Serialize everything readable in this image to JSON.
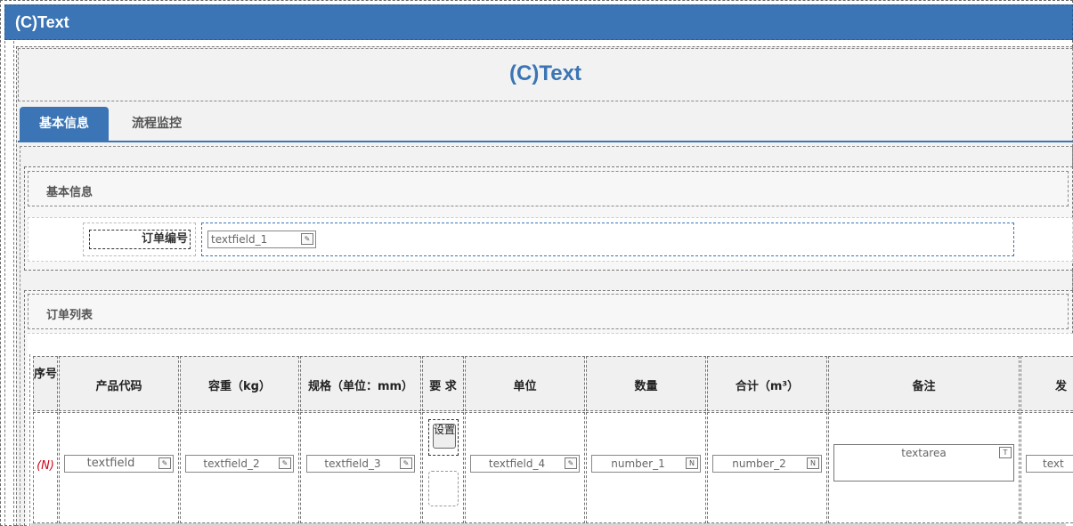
{
  "app": {
    "header_title": "(C)Text",
    "page_title": "(C)Text"
  },
  "tabs": [
    {
      "label": "基本信息",
      "active": true
    },
    {
      "label": "流程监控",
      "active": false
    }
  ],
  "basic_info": {
    "section_title": "基本信息",
    "order_no_label": "订单编号",
    "order_no_value": "textfield_1"
  },
  "order_list": {
    "section_title": "订单列表",
    "columns": {
      "seq": "序号",
      "product_code": "产品代码",
      "weight": "容重（kg）",
      "spec": "规格（单位：mm）",
      "requirement": "要 求",
      "unit": "单位",
      "quantity": "数量",
      "total": "合计（m³）",
      "remark": "备注",
      "ship": "发"
    },
    "row": {
      "seq": "(N)",
      "product_code": "textfield",
      "weight": "textfield_2",
      "spec": "textfield_3",
      "requirement_button": "设置",
      "unit": "textfield_4",
      "quantity": "number_1",
      "total": "number_2",
      "remark": "textarea",
      "ship": "text"
    }
  },
  "icons": {
    "edit": "edit-icon",
    "number": "number-icon",
    "textarea": "textarea-icon"
  },
  "colors": {
    "primary": "#3b75b5",
    "required_marker": "#d0021b"
  }
}
